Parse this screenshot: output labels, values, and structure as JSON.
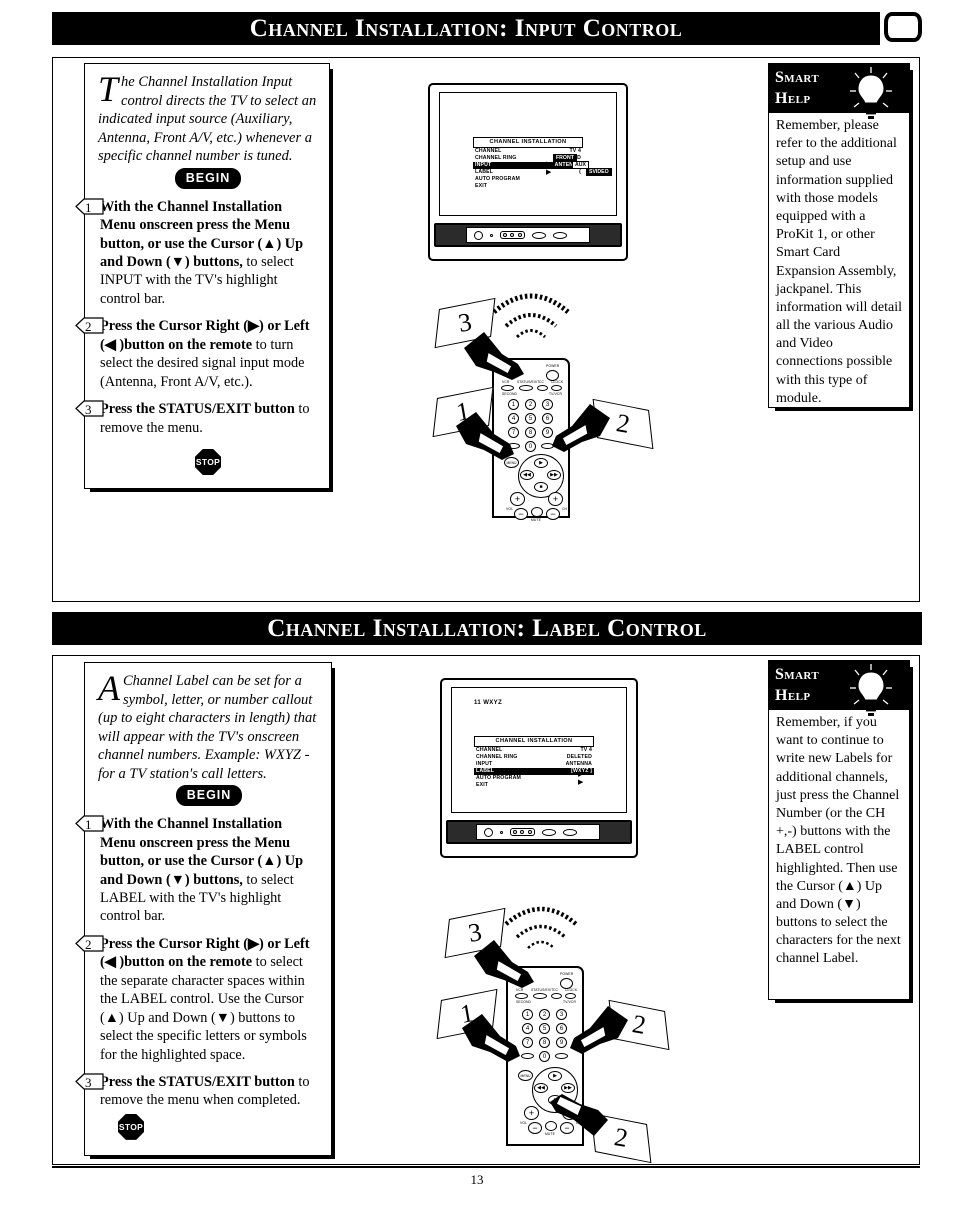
{
  "document": {
    "page_number": "13",
    "corner_icon": "tv-screen-icon"
  },
  "sections": [
    {
      "id": "input-control",
      "header": "Channel Installation: Input Control",
      "intro": {
        "dropcap": "T",
        "text": "he Channel Installation Input control directs the TV to select an indicated input source (Auxiliary, Antenna, Front A/V, etc.) whenever a specific channel number is tuned."
      },
      "begin_label": "BEGIN",
      "steps": [
        {
          "number": "1",
          "bold": "With the Channel Installation Menu onscreen press the Menu button, or use the Cursor (▲) Up and Down (▼) buttons,",
          "rest": " to select INPUT with the TV's highlight control bar."
        },
        {
          "number": "2",
          "bold": "Press the Cursor Right (▶) or Left (◀ )button on the remote",
          "rest": " to turn select the desired signal input mode (Antenna, Front A/V, etc.)."
        },
        {
          "number": "3",
          "bold": "Press the STATUS/EXIT button",
          "rest": " to remove the menu."
        }
      ],
      "stop_label": "STOP",
      "help": {
        "title_line1": "Smart",
        "title_line2": "Help",
        "body": "Remember, please refer to the additional  setup and use information supplied with those models equipped with a ProKit 1, or other Smart Card Expansion Assembly, jackpanel. This information will detail all the various Audio and Video connections possible with this type of  module."
      },
      "osd": {
        "top_label": "",
        "title": "CHANNEL INSTALLATION",
        "rows": [
          {
            "name": "CHANNEL",
            "value": "TV  4",
            "highlight": false
          },
          {
            "name": "CHANNEL RING",
            "value": "DELETED",
            "highlight": false
          },
          {
            "name": "INPUT",
            "value": "ANTENNA",
            "highlight": true
          },
          {
            "name": "LABEL",
            "value": "(",
            "highlight": false
          },
          {
            "name": "AUTO PROGRAM",
            "value": "",
            "highlight": false
          },
          {
            "name": "EXIT",
            "value": "",
            "highlight": false
          }
        ],
        "submenu": [
          "FRONT",
          "AUX",
          "SVIDEO"
        ]
      },
      "callouts": [
        "1",
        "2",
        "3"
      ]
    },
    {
      "id": "label-control",
      "header": "Channel Installation: Label Control",
      "intro": {
        "dropcap": "A",
        "text": " Channel Label can be set for a symbol, letter, or number callout (up to eight characters in length) that will appear with the TV's onscreen channel numbers. Example: WXYZ - for a TV station's call letters."
      },
      "begin_label": "BEGIN",
      "steps": [
        {
          "number": "1",
          "bold": "With the Channel Installation Menu onscreen press the Menu button, or use the Cursor (▲) Up and Down (▼) buttons,",
          "rest": " to select LABEL with the TV's highlight control bar."
        },
        {
          "number": "2",
          "bold": "Press the Cursor Right (▶) or Left (◀ )button on the remote",
          "rest": " to select the separate character spaces within the LABEL control. Use the Cursor (▲) Up and Down (▼) buttons to select the specific letters or symbols for the highlighted space."
        },
        {
          "number": "3",
          "bold": "Press the STATUS/EXIT button",
          "rest": " to remove the menu when completed."
        }
      ],
      "stop_label": "STOP",
      "help": {
        "title_line1": "Smart",
        "title_line2": "Help",
        "body": "Remember, if you want to continue to write new Labels for additional channels, just press the Channel Number (or  the CH +,-) buttons with the LABEL control highlighted. Then use the Cursor (▲) Up and Down (▼) buttons to select the characters for the next channel Label."
      },
      "osd": {
        "top_label": "11 WXYZ",
        "title": "CHANNEL INSTALLATION",
        "rows": [
          {
            "name": "CHANNEL",
            "value": "TV  4",
            "highlight": false
          },
          {
            "name": "CHANNEL RING",
            "value": "DELETED",
            "highlight": false
          },
          {
            "name": "INPUT",
            "value": "ANTENNA",
            "highlight": false
          },
          {
            "name": "LABEL",
            "value": "[WXYZ  ]",
            "highlight": true
          },
          {
            "name": "AUTO PROGRAM",
            "value": "",
            "highlight": false
          },
          {
            "name": "EXIT",
            "value": "",
            "highlight": false
          }
        ],
        "submenu": []
      },
      "callouts": [
        "1",
        "2",
        "3",
        "2"
      ]
    }
  ],
  "remote": {
    "power_label": "POWER",
    "top_buttons": [
      "VCR",
      "STATUS/EXIT",
      "CC",
      "CLOCK"
    ],
    "side_labels": [
      "TV",
      "VCR",
      "CBL"
    ],
    "sub_labels": [
      "SECOND",
      "TV/VCR"
    ],
    "keypad": [
      "1",
      "2",
      "3",
      "4",
      "5",
      "6",
      "7",
      "8",
      "9",
      "0"
    ],
    "keypad_sub": [
      "SMART",
      "SMART"
    ],
    "menu_label": "MENU",
    "cursor_glyphs": {
      "up": "▲",
      "down": "▼",
      "left": "◀◀",
      "right": "▶▶",
      "center": "■",
      "play": "▶"
    },
    "vol_label": "VOL",
    "ch_label": "CH",
    "mute_label": "MUTE",
    "plus": "+",
    "minus": "−"
  }
}
